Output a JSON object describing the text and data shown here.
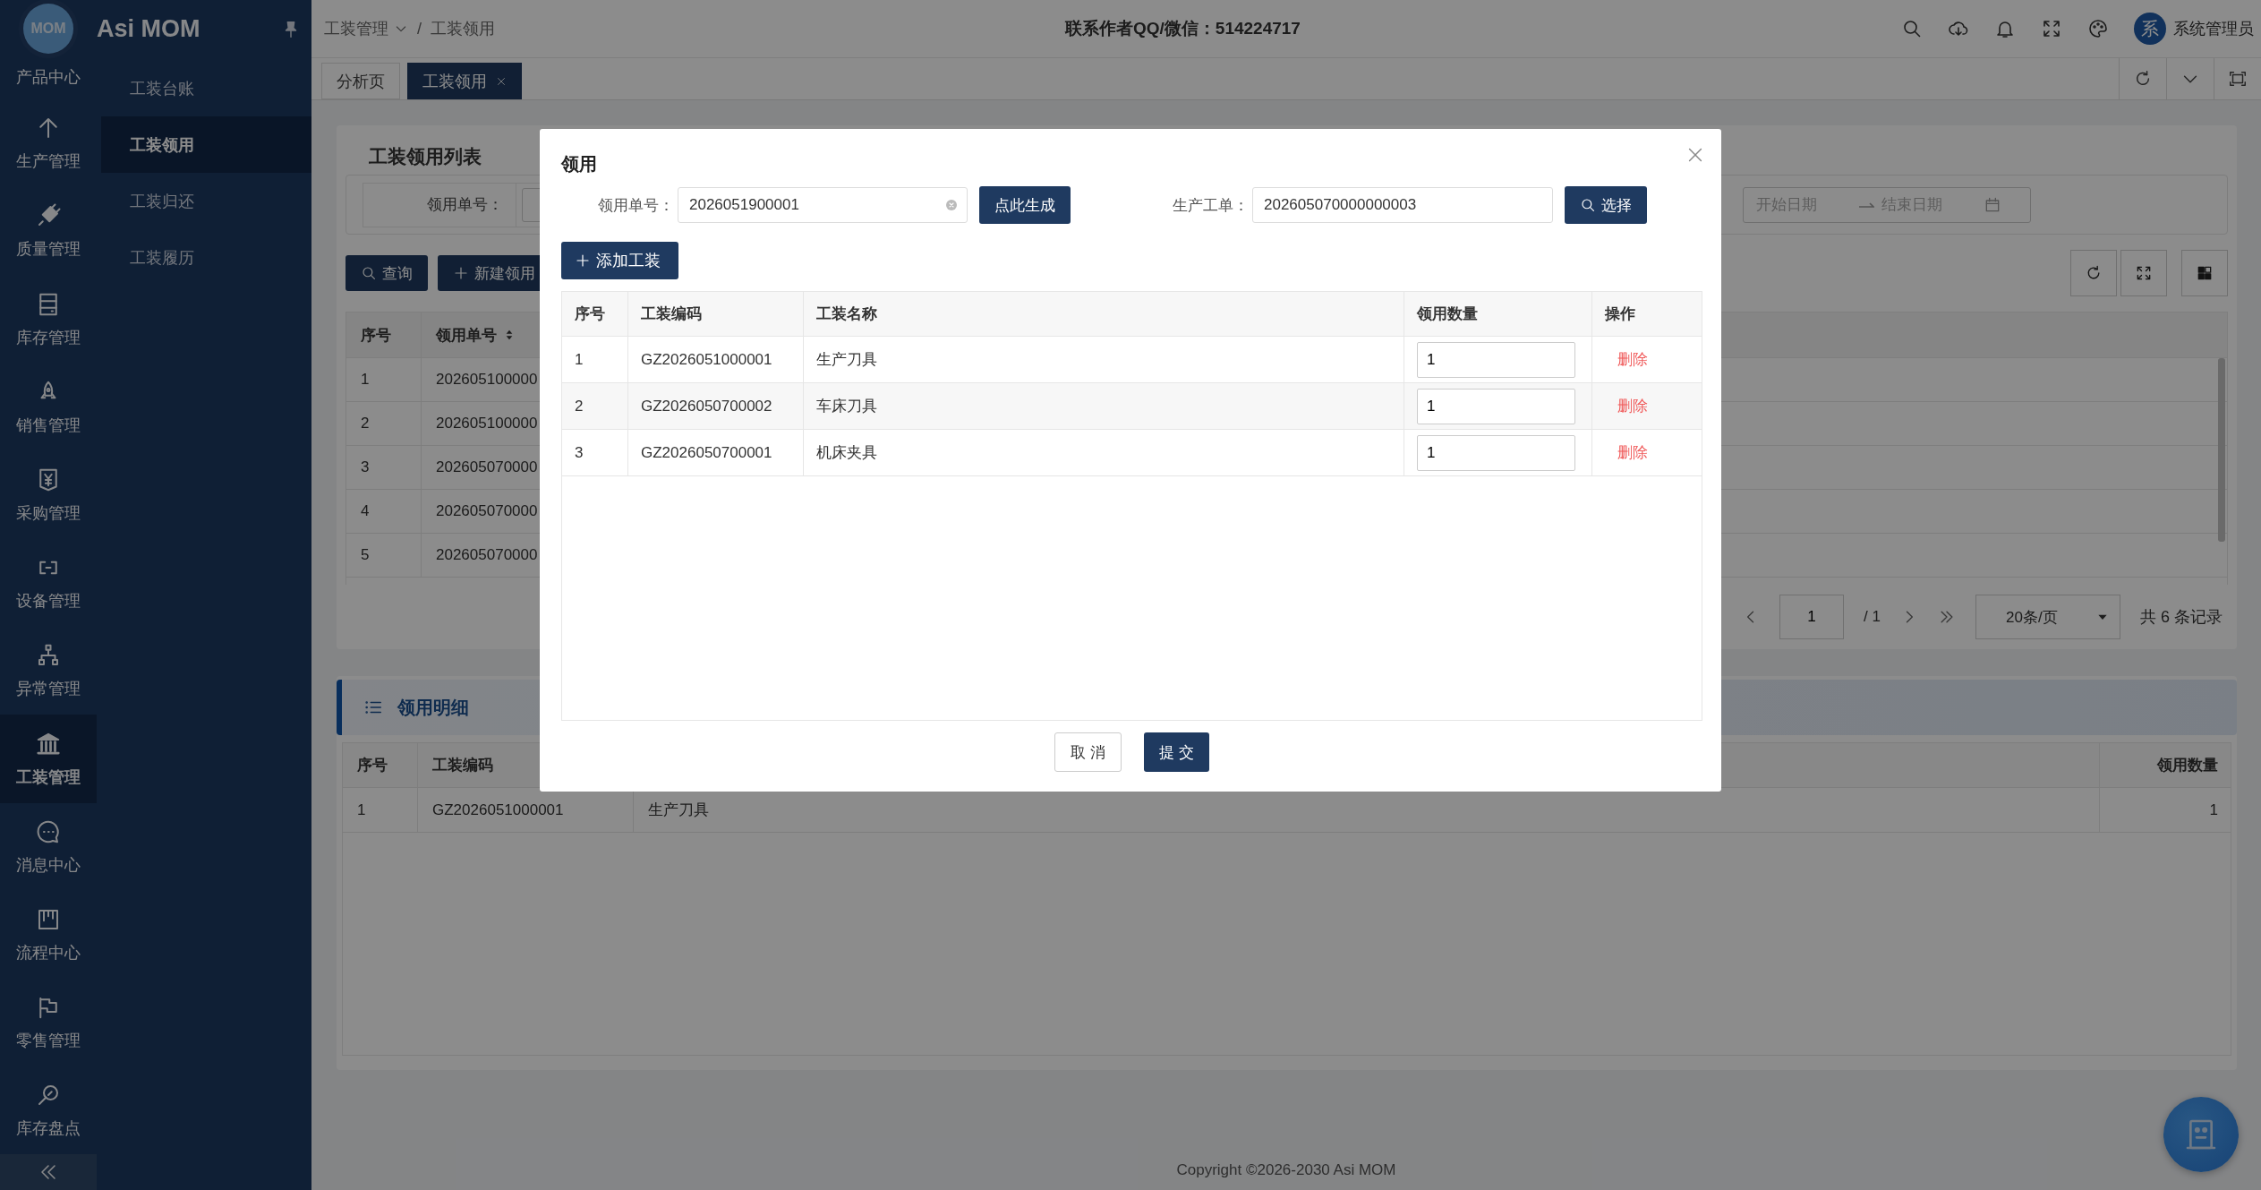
{
  "brand": {
    "logo_text": "MOM",
    "name": "Asi MOM"
  },
  "rail": {
    "logo_label": "产品中心",
    "items": [
      {
        "label": "生产管理",
        "selected": false
      },
      {
        "label": "质量管理",
        "selected": false
      },
      {
        "label": "库存管理",
        "selected": false
      },
      {
        "label": "销售管理",
        "selected": false
      },
      {
        "label": "采购管理",
        "selected": false
      },
      {
        "label": "设备管理",
        "selected": false
      },
      {
        "label": "异常管理",
        "selected": false
      },
      {
        "label": "工装管理",
        "selected": true
      },
      {
        "label": "消息中心",
        "selected": false
      },
      {
        "label": "流程中心",
        "selected": false
      },
      {
        "label": "零售管理",
        "selected": false
      },
      {
        "label": "库存盘点",
        "selected": false
      }
    ]
  },
  "submenu": [
    {
      "label": "工装台账",
      "selected": false
    },
    {
      "label": "工装领用",
      "selected": true
    },
    {
      "label": "工装归还",
      "selected": false
    },
    {
      "label": "工装履历",
      "selected": false
    }
  ],
  "header": {
    "breadcrumb": [
      "工装管理",
      "工装领用"
    ],
    "separator": "/",
    "contact": "联系作者QQ/微信：514224717",
    "user": {
      "avatar": "系",
      "name": "系统管理员"
    }
  },
  "tabs": [
    {
      "label": "分析页",
      "selected": false,
      "closable": false
    },
    {
      "label": "工装领用",
      "selected": true,
      "closable": true
    }
  ],
  "list_card": {
    "title": "工装领用列表",
    "filter_label": "领用单号：",
    "date_range": {
      "start_placeholder": "开始日期",
      "end_placeholder": "结束日期"
    },
    "buttons": [
      {
        "label": "查询",
        "kind": "search"
      },
      {
        "label": "新建领用",
        "kind": "add"
      }
    ],
    "table": {
      "columns": [
        {
          "label": "序号",
          "sortable": false
        },
        {
          "label": "领用单号",
          "sortable": true
        }
      ],
      "rows": [
        [
          "1",
          "202605100000"
        ],
        [
          "2",
          "202605100000"
        ],
        [
          "3",
          "202605070000"
        ],
        [
          "4",
          "202605070000"
        ],
        [
          "5",
          "202605070000"
        ]
      ]
    },
    "pagination": {
      "page": "1",
      "pages": "/ 1",
      "page_size": "20条/页",
      "total": "共 6 条记录"
    }
  },
  "detail": {
    "title": "领用明细",
    "columns": [
      {
        "label": "序号"
      },
      {
        "label": "工装编码"
      },
      {},
      {
        "label": "领用数量"
      }
    ],
    "rows": [
      [
        "1",
        "GZ2026051000001",
        "生产刀具",
        "1"
      ]
    ]
  },
  "modal": {
    "title": "领用",
    "fields": [
      {
        "label": "领用单号：",
        "value": "2026051900001",
        "clearable": true,
        "button": {
          "label": "点此生成",
          "kind": "plain"
        }
      },
      {
        "label": "生产工单：",
        "value": "202605070000000003",
        "clearable": false,
        "button": {
          "label": "选择",
          "kind": "search"
        }
      }
    ],
    "add_button": "添加工装",
    "table": {
      "columns": [
        "序号",
        "工装编码",
        "工装名称",
        "领用数量",
        "操作"
      ],
      "rows": [
        {
          "index": "1",
          "code": "GZ2026051000001",
          "name": "生产刀具",
          "quantity": "1",
          "action": "删除"
        },
        {
          "index": "2",
          "code": "GZ2026050700002",
          "name": "车床刀具",
          "quantity": "1",
          "action": "删除"
        },
        {
          "index": "3",
          "code": "GZ2026050700001",
          "name": "机床夹具",
          "quantity": "1",
          "action": "删除"
        }
      ]
    },
    "footer_buttons": [
      {
        "label": "取 消",
        "kind": "default"
      },
      {
        "label": "提 交",
        "kind": "primary"
      }
    ]
  },
  "footer": {
    "copyright": "Copyright ©2026-2030 Asi MOM"
  }
}
